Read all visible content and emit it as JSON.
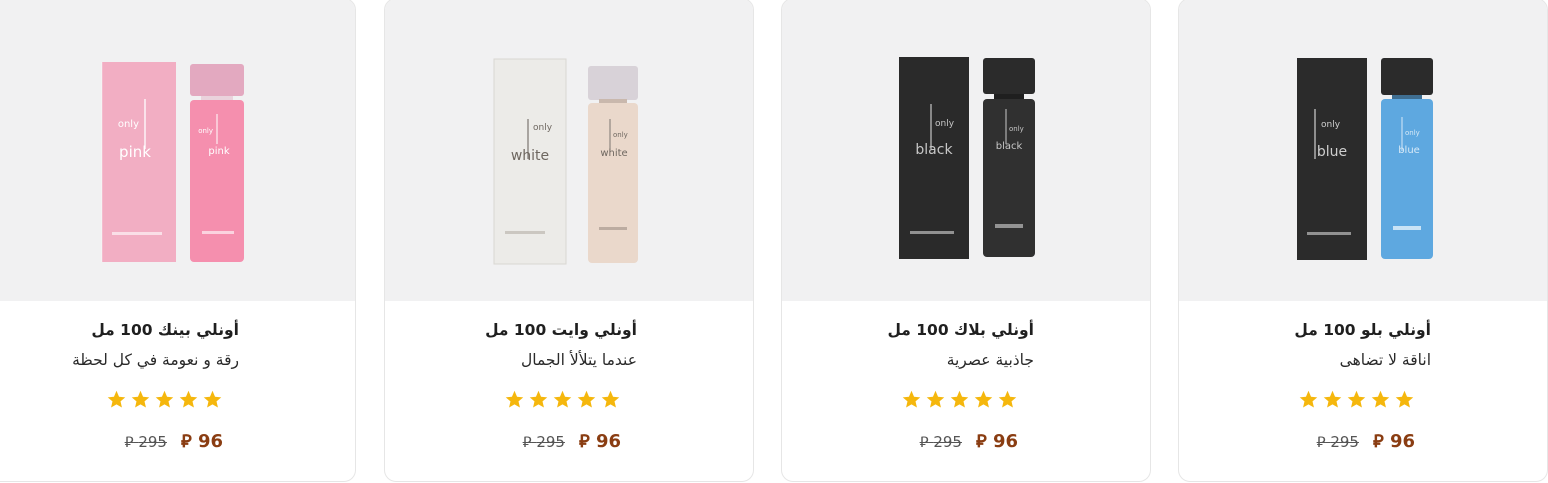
{
  "currency_symbol": "⃁",
  "star_color": "#f5b70d",
  "price_new_color": "#8a3d12",
  "products": [
    {
      "title": "أونلي بينك 100 مل",
      "tagline": "رقة و نعومة في كل لحظة",
      "rating": 5,
      "price": "96",
      "old_price": "295",
      "image": {
        "word_top": "only",
        "word_main": "pink",
        "box_color": "#f2aec3",
        "bottle_color": "#f58fae",
        "cap_color": "#e3a9c0",
        "text_color": "#ffffff"
      }
    },
    {
      "title": "أونلي وايت 100 مل",
      "tagline": "عندما يتلألأ الجمال",
      "rating": 5,
      "price": "96",
      "old_price": "295",
      "image": {
        "word_top": "only",
        "word_main": "white",
        "box_color": "#ecebe8",
        "bottle_color": "#ead8cb",
        "cap_color": "#d8d2d8",
        "text_color": "#6e6760"
      }
    },
    {
      "title": "أونلي بلاك 100 مل",
      "tagline": "جاذبية عصرية",
      "rating": 5,
      "price": "96",
      "old_price": "295",
      "image": {
        "word_top": "only",
        "word_main": "black",
        "box_color": "#2a2a2a",
        "bottle_color": "#303030",
        "cap_color": "#2b2b2b",
        "text_color": "#c7c7c7"
      }
    },
    {
      "title": "أونلي بلو 100 مل",
      "tagline": "اناقة لا تضاهى",
      "rating": 5,
      "price": "96",
      "old_price": "295",
      "image": {
        "word_top": "only",
        "word_main": "blue",
        "box_color": "#2b2b2b",
        "bottle_color": "#5ea8e0",
        "cap_color": "#2b2b2b",
        "text_color": "#cfcfcf"
      }
    }
  ]
}
